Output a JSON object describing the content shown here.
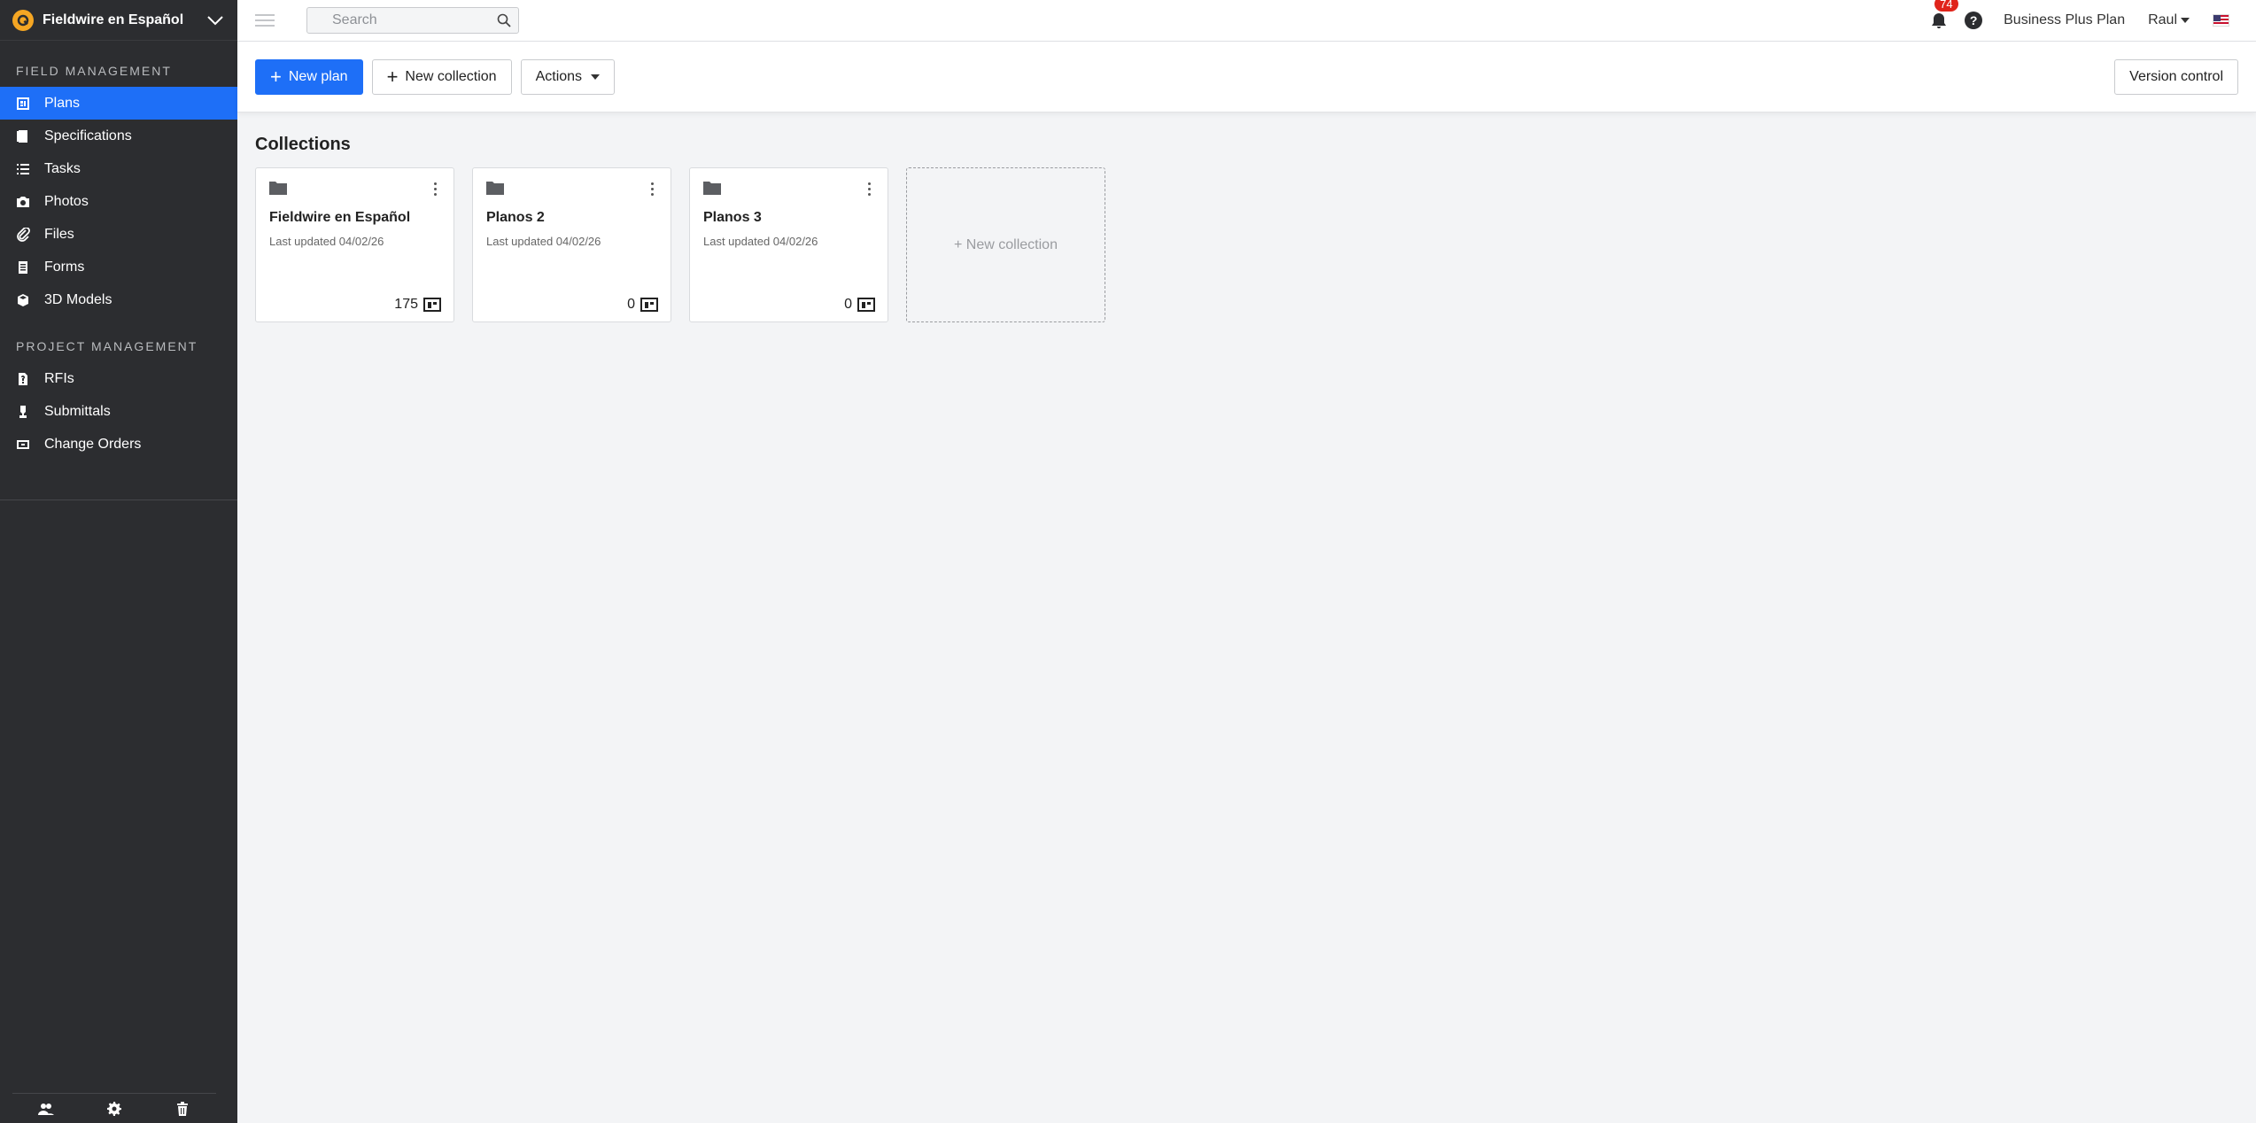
{
  "project": {
    "name": "Fieldwire en Español"
  },
  "sidebar": {
    "field_management_title": "FIELD MANAGEMENT",
    "field_items": [
      {
        "label": "Plans",
        "icon": "plans-icon",
        "active": true
      },
      {
        "label": "Specifications",
        "icon": "specifications-icon"
      },
      {
        "label": "Tasks",
        "icon": "tasks-icon"
      },
      {
        "label": "Photos",
        "icon": "camera-icon"
      },
      {
        "label": "Files",
        "icon": "paperclip-icon"
      },
      {
        "label": "Forms",
        "icon": "forms-icon"
      },
      {
        "label": "3D Models",
        "icon": "cube-icon"
      }
    ],
    "project_management_title": "PROJECT MANAGEMENT",
    "project_items": [
      {
        "label": "RFIs",
        "icon": "rfi-icon"
      },
      {
        "label": "Submittals",
        "icon": "submittals-icon"
      },
      {
        "label": "Change Orders",
        "icon": "change-orders-icon"
      }
    ],
    "footer_icons": [
      "people-icon",
      "gear-icon",
      "trash-icon"
    ]
  },
  "topbar": {
    "search_placeholder": "Search",
    "notification_count": "74",
    "help_label": "?",
    "plan_name": "Business Plus Plan",
    "user_name": "Raul"
  },
  "toolbar": {
    "new_plan": "New plan",
    "new_collection": "New collection",
    "actions": "Actions",
    "version_control": "Version control"
  },
  "main": {
    "title": "Collections",
    "cards": [
      {
        "title": "Fieldwire en Español",
        "meta": "Last updated  04/02/26",
        "count": "175"
      },
      {
        "title": "Planos 2",
        "meta": "Last updated  04/02/26",
        "count": "0"
      },
      {
        "title": "Planos 3",
        "meta": "Last updated  04/02/26",
        "count": "0"
      }
    ],
    "new_collection_label": "+ New collection"
  },
  "colors": {
    "accent": "#1e6ff7",
    "sidebar_bg": "#2c2d30",
    "badge": "#e0241b"
  }
}
